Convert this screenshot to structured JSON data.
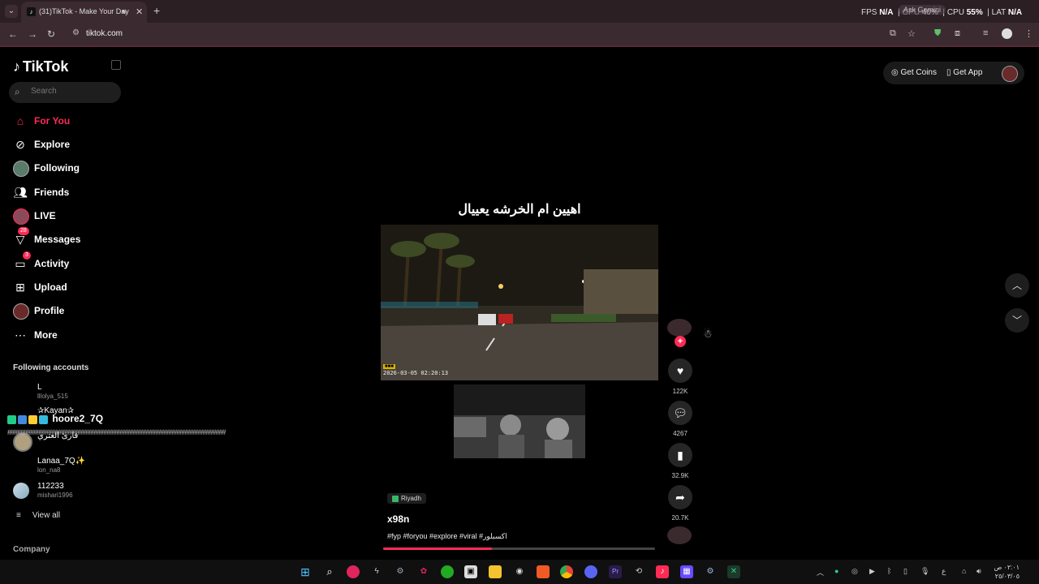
{
  "browser": {
    "tab_title": "(31)TikTok - Make Your Day",
    "url": "tiktok.com",
    "ask_gemini": "Ask Gemini",
    "stats": {
      "fps_label": "FPS",
      "fps": "N/A",
      "gpu_label": "GPU",
      "gpu": "40%",
      "cpu_label": "CPU",
      "cpu": "55%",
      "lat_label": "LAT",
      "lat": "N/A"
    }
  },
  "sidebar": {
    "logo": "TikTok",
    "search_placeholder": "Search",
    "nav": [
      {
        "label": "For You",
        "icon": "home-icon"
      },
      {
        "label": "Explore",
        "icon": "compass-icon"
      },
      {
        "label": "Following",
        "icon": "following-avatar-icon"
      },
      {
        "label": "Friends",
        "icon": "friends-icon"
      },
      {
        "label": "LIVE",
        "icon": "live-avatar-icon"
      },
      {
        "label": "Messages",
        "icon": "messages-icon",
        "badge": "28"
      },
      {
        "label": "Activity",
        "icon": "activity-icon",
        "badge": "3"
      },
      {
        "label": "Upload",
        "icon": "upload-icon"
      },
      {
        "label": "Profile",
        "icon": "profile-avatar-icon"
      },
      {
        "label": "More",
        "icon": "more-icon"
      }
    ],
    "following_title": "Following accounts",
    "accounts": [
      {
        "name": "L",
        "username": "lllolya_515"
      },
      {
        "name": "✰Kayan✰",
        "username": ""
      },
      {
        "name": "قارئ العتري",
        "username": ""
      },
      {
        "name": "Lanaa_7Q✨",
        "username": "lon_na8"
      },
      {
        "name": "112233",
        "username": "mishari1996"
      }
    ],
    "view_all": "View all",
    "company": "Company"
  },
  "stream_overlay": {
    "name": "hoore2_7Q",
    "hash_line": "###################################################################"
  },
  "header": {
    "get_coins": "Get Coins",
    "get_app": "Get App"
  },
  "video": {
    "caption": "اهيين ام الخرشه يعييال",
    "timestamp": "2026-03-05 02:20:13",
    "location": "Riyadh",
    "author": "x98n",
    "description": "#fyp #foryou #explore #viral #اكسبلور",
    "progress": 0.4
  },
  "actions": {
    "likes": "122K",
    "comments": "4267",
    "saves": "32.9K",
    "shares": "20.7K"
  },
  "taskbar": {
    "clock_time": "٠٢:٠١ ص",
    "clock_date": "٢٥/٠٣/٠٥"
  },
  "colors": {
    "accent": "#fe2c55",
    "browser_bg": "#3b2b31"
  }
}
